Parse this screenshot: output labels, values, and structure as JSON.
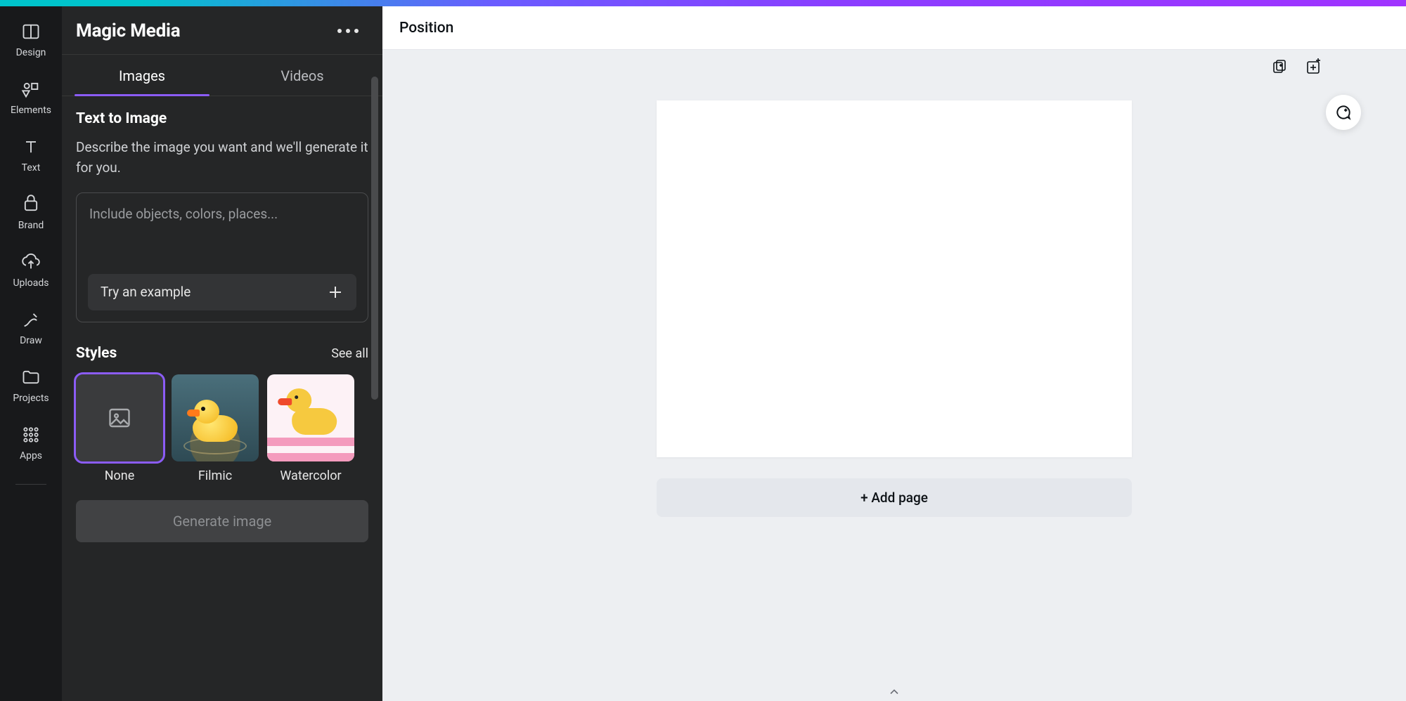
{
  "rail": {
    "items": [
      {
        "label": "Design"
      },
      {
        "label": "Elements"
      },
      {
        "label": "Text"
      },
      {
        "label": "Brand"
      },
      {
        "label": "Uploads"
      },
      {
        "label": "Draw"
      },
      {
        "label": "Projects"
      },
      {
        "label": "Apps"
      }
    ]
  },
  "panel": {
    "title": "Magic Media",
    "tabs": {
      "images": "Images",
      "videos": "Videos",
      "active": "images"
    },
    "text_to_image": {
      "heading": "Text to Image",
      "description": "Describe the image you want and we'll generate it for you.",
      "placeholder": "Include objects, colors, places...",
      "try_example": "Try an example"
    },
    "styles": {
      "heading": "Styles",
      "see_all": "See all",
      "items": [
        {
          "name": "None",
          "selected": true
        },
        {
          "name": "Filmic",
          "selected": false
        },
        {
          "name": "Watercolor",
          "selected": false
        }
      ]
    },
    "generate_button": "Generate image"
  },
  "topbar": {
    "position": "Position"
  },
  "canvas": {
    "add_page": "+ Add page"
  }
}
